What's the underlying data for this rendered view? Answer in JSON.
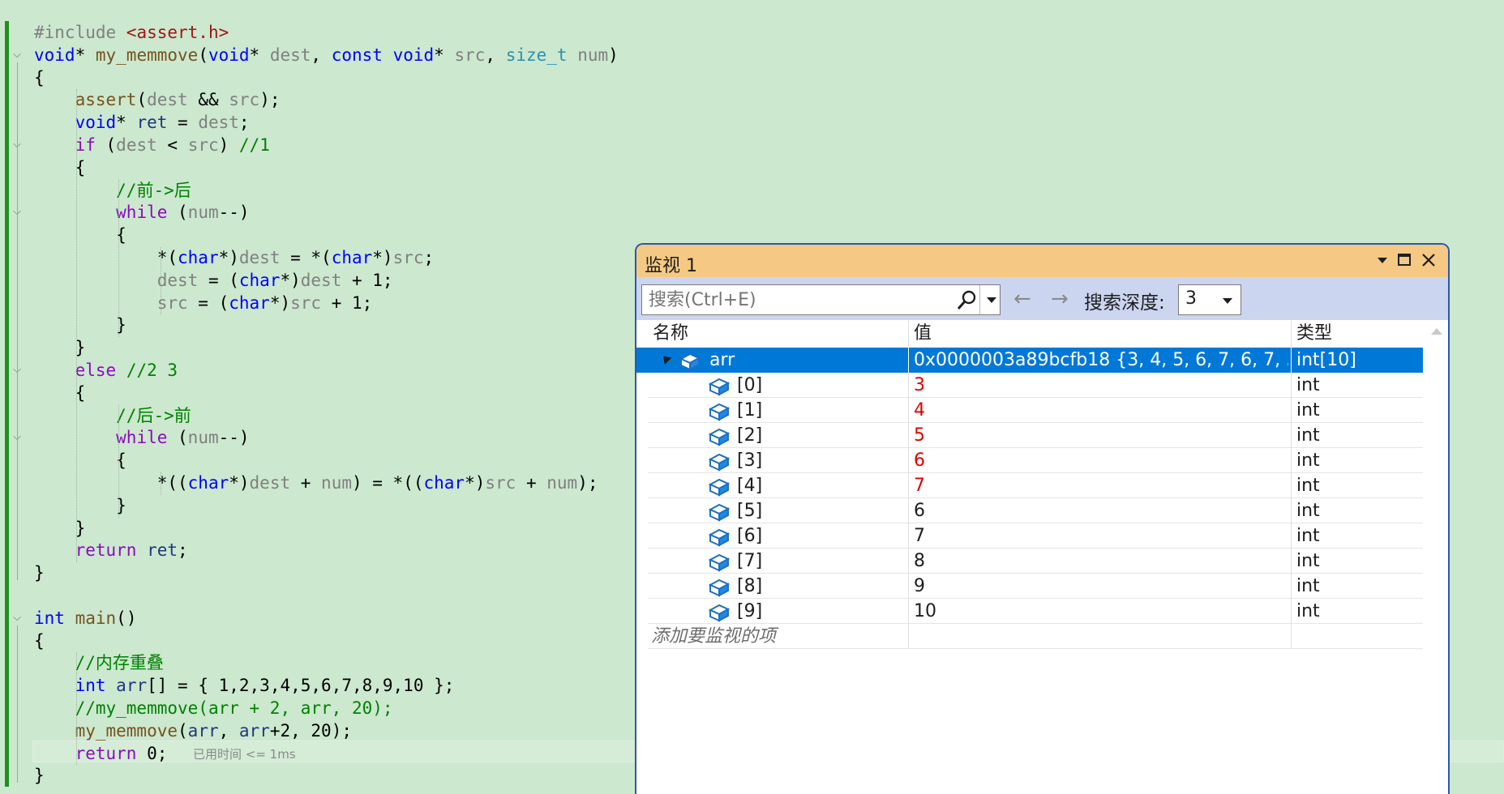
{
  "editor": {
    "lines": [
      [
        [
          "pp",
          "#include "
        ],
        [
          "st",
          "<assert.h>"
        ]
      ],
      [
        [
          "kw",
          "void"
        ],
        [
          "",
          "* "
        ],
        [
          "fn",
          "my_memmove"
        ],
        [
          "",
          "("
        ],
        [
          "kw",
          "void"
        ],
        [
          "",
          "* "
        ],
        [
          "pm",
          "dest"
        ],
        [
          "",
          ", "
        ],
        [
          "kw",
          "const void"
        ],
        [
          "",
          "* "
        ],
        [
          "pm",
          "src"
        ],
        [
          "",
          ", "
        ],
        [
          "ty",
          "size_t"
        ],
        [
          "pm",
          " num"
        ],
        [
          "",
          ")"
        ]
      ],
      [
        [
          "",
          "{"
        ]
      ],
      [
        [
          "",
          "    "
        ],
        [
          "fn",
          "assert"
        ],
        [
          "",
          "("
        ],
        [
          "pm",
          "dest"
        ],
        [
          "",
          " && "
        ],
        [
          "pm",
          "src"
        ],
        [
          "",
          ");"
        ]
      ],
      [
        [
          "",
          "    "
        ],
        [
          "kw",
          "void"
        ],
        [
          "",
          "* "
        ],
        [
          "lv",
          "ret"
        ],
        [
          "",
          " = "
        ],
        [
          "pm",
          "dest"
        ],
        [
          "",
          ";"
        ]
      ],
      [
        [
          "",
          "    "
        ],
        [
          "kp",
          "if"
        ],
        [
          "",
          " ("
        ],
        [
          "pm",
          "dest"
        ],
        [
          "",
          " < "
        ],
        [
          "pm",
          "src"
        ],
        [
          "",
          ") "
        ],
        [
          "cm",
          "//1"
        ]
      ],
      [
        [
          "",
          "    {"
        ]
      ],
      [
        [
          "",
          "        "
        ],
        [
          "cm",
          "//前->后"
        ]
      ],
      [
        [
          "",
          "        "
        ],
        [
          "kp",
          "while"
        ],
        [
          "",
          " ("
        ],
        [
          "pm",
          "num"
        ],
        [
          "",
          "--)"
        ]
      ],
      [
        [
          "",
          "        {"
        ]
      ],
      [
        [
          "",
          "            *("
        ],
        [
          "kw",
          "char"
        ],
        [
          "",
          "*)"
        ],
        [
          "pm",
          "dest"
        ],
        [
          "",
          " = *("
        ],
        [
          "kw",
          "char"
        ],
        [
          "",
          "*)"
        ],
        [
          "pm",
          "src"
        ],
        [
          "",
          ";"
        ]
      ],
      [
        [
          "",
          "            "
        ],
        [
          "pm",
          "dest"
        ],
        [
          "",
          " = ("
        ],
        [
          "kw",
          "char"
        ],
        [
          "",
          "*)"
        ],
        [
          "pm",
          "dest"
        ],
        [
          "",
          " + 1;"
        ]
      ],
      [
        [
          "",
          "            "
        ],
        [
          "pm",
          "src"
        ],
        [
          "",
          " = ("
        ],
        [
          "kw",
          "char"
        ],
        [
          "",
          "*)"
        ],
        [
          "pm",
          "src"
        ],
        [
          "",
          " + 1;"
        ]
      ],
      [
        [
          "",
          "        }"
        ]
      ],
      [
        [
          "",
          "    }"
        ]
      ],
      [
        [
          "",
          "    "
        ],
        [
          "kp",
          "else"
        ],
        [
          "",
          " "
        ],
        [
          "cm",
          "//2 3"
        ]
      ],
      [
        [
          "",
          "    {"
        ]
      ],
      [
        [
          "",
          "        "
        ],
        [
          "cm",
          "//后->前"
        ]
      ],
      [
        [
          "",
          "        "
        ],
        [
          "kp",
          "while"
        ],
        [
          "",
          " ("
        ],
        [
          "pm",
          "num"
        ],
        [
          "",
          "--)"
        ]
      ],
      [
        [
          "",
          "        {"
        ]
      ],
      [
        [
          "",
          "            *(("
        ],
        [
          "kw",
          "char"
        ],
        [
          "",
          "*)"
        ],
        [
          "pm",
          "dest"
        ],
        [
          "",
          " + "
        ],
        [
          "pm",
          "num"
        ],
        [
          "",
          ") = *(("
        ],
        [
          "kw",
          "char"
        ],
        [
          "",
          "*)"
        ],
        [
          "pm",
          "src"
        ],
        [
          "",
          " + "
        ],
        [
          "pm",
          "num"
        ],
        [
          "",
          ");"
        ]
      ],
      [
        [
          "",
          "        }"
        ]
      ],
      [
        [
          "",
          "    }"
        ]
      ],
      [
        [
          "",
          "    "
        ],
        [
          "kp",
          "return"
        ],
        [
          "",
          " "
        ],
        [
          "lv",
          "ret"
        ],
        [
          "",
          ";"
        ]
      ],
      [
        [
          "",
          "}"
        ]
      ],
      [
        [
          "",
          ""
        ]
      ],
      [
        [
          "kw",
          "int"
        ],
        [
          "",
          " "
        ],
        [
          "fn",
          "main"
        ],
        [
          "",
          "()"
        ]
      ],
      [
        [
          "",
          "{"
        ]
      ],
      [
        [
          "",
          "    "
        ],
        [
          "cm",
          "//内存重叠"
        ]
      ],
      [
        [
          "",
          "    "
        ],
        [
          "kw",
          "int"
        ],
        [
          "",
          " "
        ],
        [
          "lv",
          "arr"
        ],
        [
          "",
          "[] = { 1,2,3,4,5,6,7,8,9,10 };"
        ]
      ],
      [
        [
          "",
          "    "
        ],
        [
          "cm",
          "//my_memmove(arr + 2, arr, 20);"
        ]
      ],
      [
        [
          "",
          "    "
        ],
        [
          "fn",
          "my_memmove"
        ],
        [
          "",
          "("
        ],
        [
          "lv",
          "arr"
        ],
        [
          "",
          ", "
        ],
        [
          "lv",
          "arr"
        ],
        [
          "",
          "+2, 20);"
        ]
      ],
      [
        [
          "",
          "    "
        ],
        [
          "kp",
          "return"
        ],
        [
          "",
          " 0;"
        ]
      ],
      [
        [
          "",
          "}"
        ]
      ]
    ],
    "elapsed_hint": "已用时间 <= 1ms"
  },
  "watch": {
    "title": "监视 1",
    "search_placeholder": "搜索(Ctrl+E)",
    "depth_label": "搜索深度:",
    "depth_value": "3",
    "columns": {
      "name": "名称",
      "value": "值",
      "type": "类型"
    },
    "root": {
      "name": "arr",
      "value": "0x0000003a89bcfb18 {3, 4, 5, 6, 7, 6, 7, ...",
      "type": "int[10]"
    },
    "elements": [
      {
        "name": "[0]",
        "value": "3",
        "type": "int",
        "changed": true
      },
      {
        "name": "[1]",
        "value": "4",
        "type": "int",
        "changed": true
      },
      {
        "name": "[2]",
        "value": "5",
        "type": "int",
        "changed": true
      },
      {
        "name": "[3]",
        "value": "6",
        "type": "int",
        "changed": true
      },
      {
        "name": "[4]",
        "value": "7",
        "type": "int",
        "changed": true
      },
      {
        "name": "[5]",
        "value": "6",
        "type": "int",
        "changed": false
      },
      {
        "name": "[6]",
        "value": "7",
        "type": "int",
        "changed": false
      },
      {
        "name": "[7]",
        "value": "8",
        "type": "int",
        "changed": false
      },
      {
        "name": "[8]",
        "value": "9",
        "type": "int",
        "changed": false
      },
      {
        "name": "[9]",
        "value": "10",
        "type": "int",
        "changed": false
      }
    ],
    "add_item": "添加要监视的项",
    "changed_color": "#e00000",
    "selection_color": "#0078d7"
  }
}
